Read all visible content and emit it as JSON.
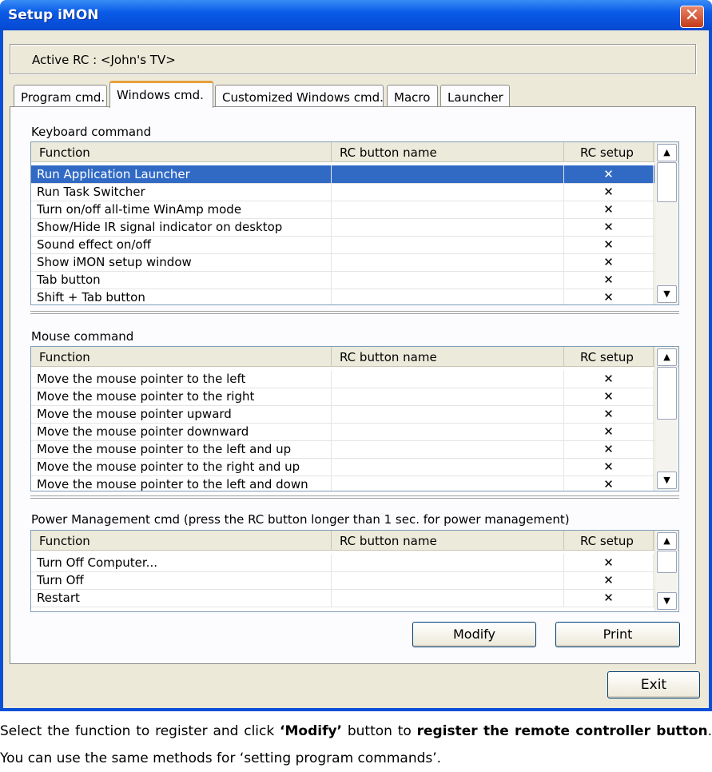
{
  "window": {
    "title": "Setup iMON",
    "close_glyph": "✕"
  },
  "active_rc": "Active RC : <John's TV>",
  "tabs": [
    {
      "label": "Program cmd."
    },
    {
      "label": "Windows cmd."
    },
    {
      "label": "Customized Windows cmd."
    },
    {
      "label": "Macro"
    },
    {
      "label": "Launcher"
    }
  ],
  "columns": {
    "function": "Function",
    "rc_button_name": "RC button name",
    "rc_setup": "RC setup"
  },
  "keyboard": {
    "label": "Keyboard command",
    "rows": [
      {
        "function": "Run Application Launcher",
        "rc": "",
        "setup": "✕"
      },
      {
        "function": "Run Task Switcher",
        "rc": "",
        "setup": "✕"
      },
      {
        "function": "Turn on/off all-time WinAmp mode",
        "rc": "",
        "setup": "✕"
      },
      {
        "function": "Show/Hide IR signal indicator on desktop",
        "rc": "",
        "setup": "✕"
      },
      {
        "function": "Sound effect on/off",
        "rc": "",
        "setup": "✕"
      },
      {
        "function": "Show iMON setup window",
        "rc": "",
        "setup": "✕"
      },
      {
        "function": "Tab button",
        "rc": "",
        "setup": "✕"
      },
      {
        "function": "Shift + Tab button",
        "rc": "",
        "setup": "✕"
      }
    ]
  },
  "mouse": {
    "label": "Mouse command",
    "rows": [
      {
        "function": "Move the mouse pointer to the left",
        "rc": "",
        "setup": "✕"
      },
      {
        "function": "Move the mouse pointer to the right",
        "rc": "",
        "setup": "✕"
      },
      {
        "function": "Move the mouse pointer upward",
        "rc": "",
        "setup": "✕"
      },
      {
        "function": "Move the mouse pointer downward",
        "rc": "",
        "setup": "✕"
      },
      {
        "function": "Move the mouse pointer to the left and up",
        "rc": "",
        "setup": "✕"
      },
      {
        "function": "Move the mouse pointer to the right and up",
        "rc": "",
        "setup": "✕"
      },
      {
        "function": "Move the mouse pointer to the left and down",
        "rc": "",
        "setup": "✕"
      }
    ]
  },
  "power": {
    "label": "Power Management cmd (press the RC button longer than 1 sec. for power management)",
    "rows": [
      {
        "function": "Turn Off Computer...",
        "rc": "",
        "setup": "✕"
      },
      {
        "function": "Turn Off",
        "rc": "",
        "setup": "✕"
      },
      {
        "function": "Restart",
        "rc": "",
        "setup": "✕"
      }
    ]
  },
  "scroll": {
    "up": "▲",
    "down": "▼"
  },
  "buttons": {
    "modify": "Modify",
    "print": "Print",
    "exit": "Exit"
  },
  "caption": {
    "p1": "Select the function to register and click ",
    "b1": "‘Modify’",
    "p2": " button to ",
    "b2": "register the remote controller button",
    "p3": ". You can use the same methods for ‘setting program commands’."
  }
}
